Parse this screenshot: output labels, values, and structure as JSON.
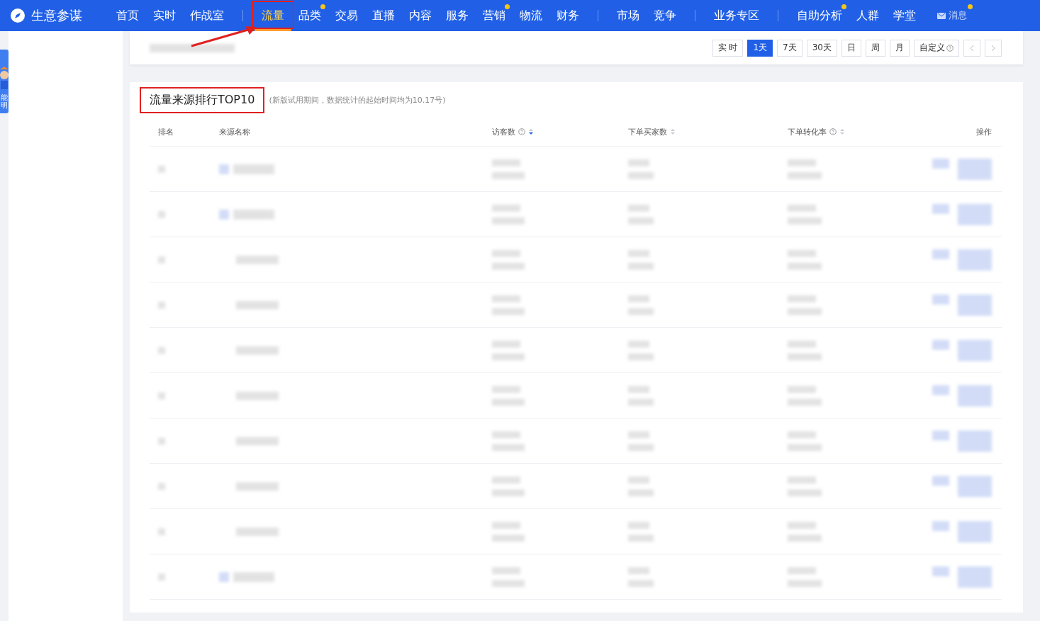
{
  "nav": {
    "brand": "生意参谋",
    "items": [
      {
        "kind": "item",
        "label": "首页",
        "selected": false,
        "dot": false,
        "highlighted": false
      },
      {
        "kind": "item",
        "label": "实时",
        "selected": false,
        "dot": false,
        "highlighted": false
      },
      {
        "kind": "item",
        "label": "作战室",
        "selected": false,
        "dot": false,
        "highlighted": false
      },
      {
        "kind": "divider"
      },
      {
        "kind": "item",
        "label": "流量",
        "selected": true,
        "dot": false,
        "highlighted": true
      },
      {
        "kind": "item",
        "label": "品类",
        "selected": false,
        "dot": true,
        "highlighted": false
      },
      {
        "kind": "item",
        "label": "交易",
        "selected": false,
        "dot": false,
        "highlighted": false
      },
      {
        "kind": "item",
        "label": "直播",
        "selected": false,
        "dot": false,
        "highlighted": false
      },
      {
        "kind": "item",
        "label": "内容",
        "selected": false,
        "dot": false,
        "highlighted": false
      },
      {
        "kind": "item",
        "label": "服务",
        "selected": false,
        "dot": false,
        "highlighted": false
      },
      {
        "kind": "item",
        "label": "营销",
        "selected": false,
        "dot": true,
        "highlighted": false
      },
      {
        "kind": "item",
        "label": "物流",
        "selected": false,
        "dot": false,
        "highlighted": false
      },
      {
        "kind": "item",
        "label": "财务",
        "selected": false,
        "dot": false,
        "highlighted": false
      },
      {
        "kind": "divider"
      },
      {
        "kind": "item",
        "label": "市场",
        "selected": false,
        "dot": false,
        "highlighted": false
      },
      {
        "kind": "item",
        "label": "竞争",
        "selected": false,
        "dot": false,
        "highlighted": false
      },
      {
        "kind": "divider"
      },
      {
        "kind": "item",
        "label": "业务专区",
        "selected": false,
        "dot": false,
        "highlighted": false
      },
      {
        "kind": "divider"
      },
      {
        "kind": "item",
        "label": "自助分析",
        "selected": false,
        "dot": true,
        "highlighted": false
      },
      {
        "kind": "item",
        "label": "人群",
        "selected": false,
        "dot": false,
        "highlighted": false
      },
      {
        "kind": "item",
        "label": "学堂",
        "selected": false,
        "dot": false,
        "highlighted": false
      },
      {
        "kind": "message",
        "label": "消息",
        "selected": false,
        "dot": true,
        "highlighted": false
      }
    ]
  },
  "side_tab": {
    "lines": [
      "能",
      "明"
    ]
  },
  "period_buttons": [
    {
      "kind": "text",
      "label": "实 时",
      "selected": false
    },
    {
      "kind": "text",
      "label": "1天",
      "selected": true
    },
    {
      "kind": "text",
      "label": "7天",
      "selected": false
    },
    {
      "kind": "text",
      "label": "30天",
      "selected": false
    },
    {
      "kind": "text",
      "label": "日",
      "selected": false
    },
    {
      "kind": "text",
      "label": "周",
      "selected": false
    },
    {
      "kind": "text",
      "label": "月",
      "selected": false
    },
    {
      "kind": "help",
      "label": "自定义",
      "selected": false
    },
    {
      "kind": "prev",
      "selected": false
    },
    {
      "kind": "next",
      "selected": false
    }
  ],
  "panel": {
    "title": "流量来源排行TOP10",
    "highlighted": true,
    "note": "(新版试用期间，数据统计的起始时间均为10.17号)",
    "table": {
      "columns": [
        {
          "label": "排名",
          "help": false,
          "sortable": false,
          "sorted": false
        },
        {
          "label": "来源名称",
          "help": false,
          "sortable": false,
          "sorted": false
        },
        {
          "label": "访客数",
          "help": true,
          "sortable": true,
          "sorted": true
        },
        {
          "label": "下单买家数",
          "help": false,
          "sortable": true,
          "sorted": false
        },
        {
          "label": "下单转化率",
          "help": true,
          "sortable": true,
          "sorted": false
        },
        {
          "label": "操作",
          "help": false,
          "sortable": false,
          "sorted": false
        }
      ],
      "rows": [
        {
          "kind": "source"
        },
        {
          "kind": "source"
        },
        {
          "kind": "sub"
        },
        {
          "kind": "sub"
        },
        {
          "kind": "sub"
        },
        {
          "kind": "sub"
        },
        {
          "kind": "sub"
        },
        {
          "kind": "sub"
        },
        {
          "kind": "sub"
        },
        {
          "kind": "source"
        }
      ]
    }
  }
}
